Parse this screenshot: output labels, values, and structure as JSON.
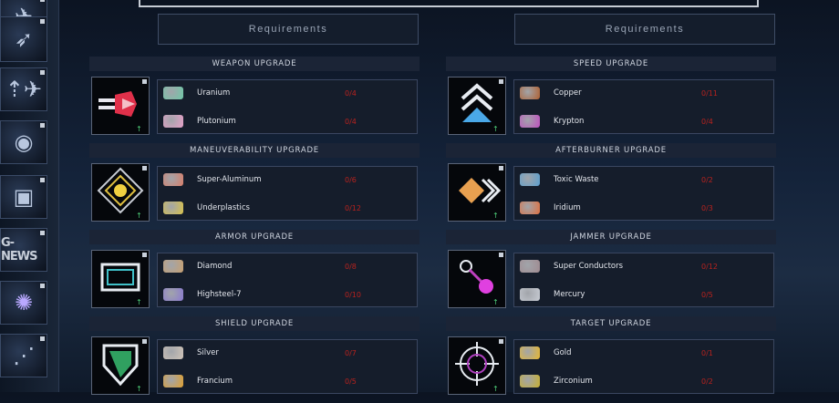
{
  "requirements_label": "Requirements",
  "colors": {
    "need": "#b8221e",
    "upgrade_arrow": "#4fd07a"
  },
  "sidebar": [
    {
      "name": "ship-icon"
    },
    {
      "name": "fighter-icon"
    },
    {
      "name": "radar-icon"
    },
    {
      "name": "cargo-icon"
    },
    {
      "name": "gnews-icon",
      "label": "G-NEWS"
    },
    {
      "name": "orb-icon"
    },
    {
      "name": "satellite-icon"
    }
  ],
  "left_column": [
    {
      "title": "WEAPON UPGRADE",
      "icon": "weapon-upgrade-icon",
      "materials": [
        {
          "name": "Uranium",
          "qty": "0/4",
          "color": "#6fc9a8"
        },
        {
          "name": "Plutonium",
          "qty": "0/4",
          "color": "#e6a0c8"
        }
      ]
    },
    {
      "title": "MANEUVERABILITY UPGRADE",
      "icon": "maneuverability-upgrade-icon",
      "materials": [
        {
          "name": "Super-Aluminum",
          "qty": "0/6",
          "color": "#d87e6a"
        },
        {
          "name": "Underplastics",
          "qty": "0/12",
          "color": "#d8c24a"
        }
      ]
    },
    {
      "title": "ARMOR UPGRADE",
      "icon": "armor-upgrade-icon",
      "materials": [
        {
          "name": "Diamond",
          "qty": "0/8",
          "color": "#c8a070"
        },
        {
          "name": "Highsteel-7",
          "qty": "0/10",
          "color": "#8a7ad0"
        }
      ]
    },
    {
      "title": "SHIELD UPGRADE",
      "icon": "shield-upgrade-icon",
      "materials": [
        {
          "name": "Silver",
          "qty": "0/7",
          "color": "#d0c4b8"
        },
        {
          "name": "Francium",
          "qty": "0/5",
          "color": "#e0a030"
        }
      ]
    }
  ],
  "right_column": [
    {
      "title": "SPEED UPGRADE",
      "icon": "speed-upgrade-icon",
      "materials": [
        {
          "name": "Copper",
          "qty": "0/11",
          "color": "#b06030"
        },
        {
          "name": "Krypton",
          "qty": "0/4",
          "color": "#c050c0"
        }
      ]
    },
    {
      "title": "AFTERBURNER UPGRADE",
      "icon": "afterburner-upgrade-icon",
      "materials": [
        {
          "name": "Toxic Waste",
          "qty": "0/2",
          "color": "#5aa0d0"
        },
        {
          "name": "Iridium",
          "qty": "0/3",
          "color": "#e07040"
        }
      ]
    },
    {
      "title": "JAMMER UPGRADE",
      "icon": "jammer-upgrade-icon",
      "materials": [
        {
          "name": "Super Conductors",
          "qty": "0/12",
          "color": "#a08a90"
        },
        {
          "name": "Mercury",
          "qty": "0/5",
          "color": "#c8ccd4"
        }
      ]
    },
    {
      "title": "TARGET UPGRADE",
      "icon": "target-upgrade-icon",
      "materials": [
        {
          "name": "Gold",
          "qty": "0/1",
          "color": "#e8b830"
        },
        {
          "name": "Zirconium",
          "qty": "0/2",
          "color": "#c8b030"
        }
      ]
    }
  ]
}
